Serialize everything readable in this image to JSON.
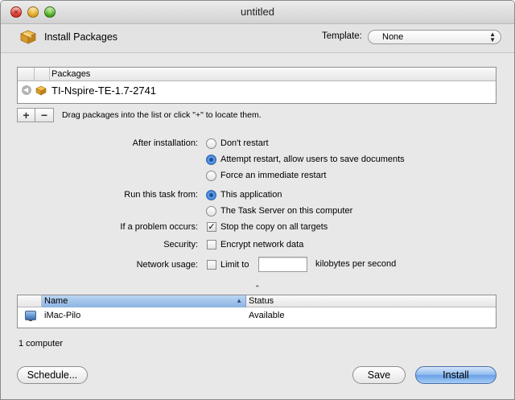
{
  "window": {
    "title": "untitled"
  },
  "header": {
    "title": "Install Packages",
    "template_label": "Template:",
    "template_value": "None"
  },
  "packages": {
    "column_header": "Packages",
    "items": [
      {
        "name": "TI-Nspire-TE-1.7-2741"
      }
    ]
  },
  "package_controls": {
    "add_label": "+",
    "remove_label": "−",
    "hint": "Drag packages into the list or click \"+\" to locate them."
  },
  "after_installation": {
    "label": "After installation:",
    "options": [
      "Don't restart",
      "Attempt restart, allow users to save documents",
      "Force an immediate restart"
    ],
    "selected": "Attempt restart, allow users to save documents"
  },
  "run_task_from": {
    "label": "Run this task from:",
    "options": [
      "This application",
      "The Task Server on this computer"
    ],
    "selected": "This application"
  },
  "problem": {
    "label": "If a problem occurs:",
    "option": "Stop the copy on all targets",
    "checked": true
  },
  "security": {
    "label": "Security:",
    "option": "Encrypt network data",
    "checked": false
  },
  "network": {
    "label": "Network usage:",
    "option": "Limit to",
    "checked": false,
    "value": "",
    "suffix": "kilobytes per second"
  },
  "computers": {
    "columns": [
      "Name",
      "Status"
    ],
    "rows": [
      {
        "name": "iMac-Pilo",
        "status": "Available"
      }
    ],
    "count_text": "1 computer"
  },
  "buttons": {
    "schedule": "Schedule...",
    "save": "Save",
    "install": "Install"
  },
  "colors": {
    "window_bg": "#e8e8e8",
    "selection_blue": "#8bb3e3",
    "default_button": "#6aa0e6"
  }
}
